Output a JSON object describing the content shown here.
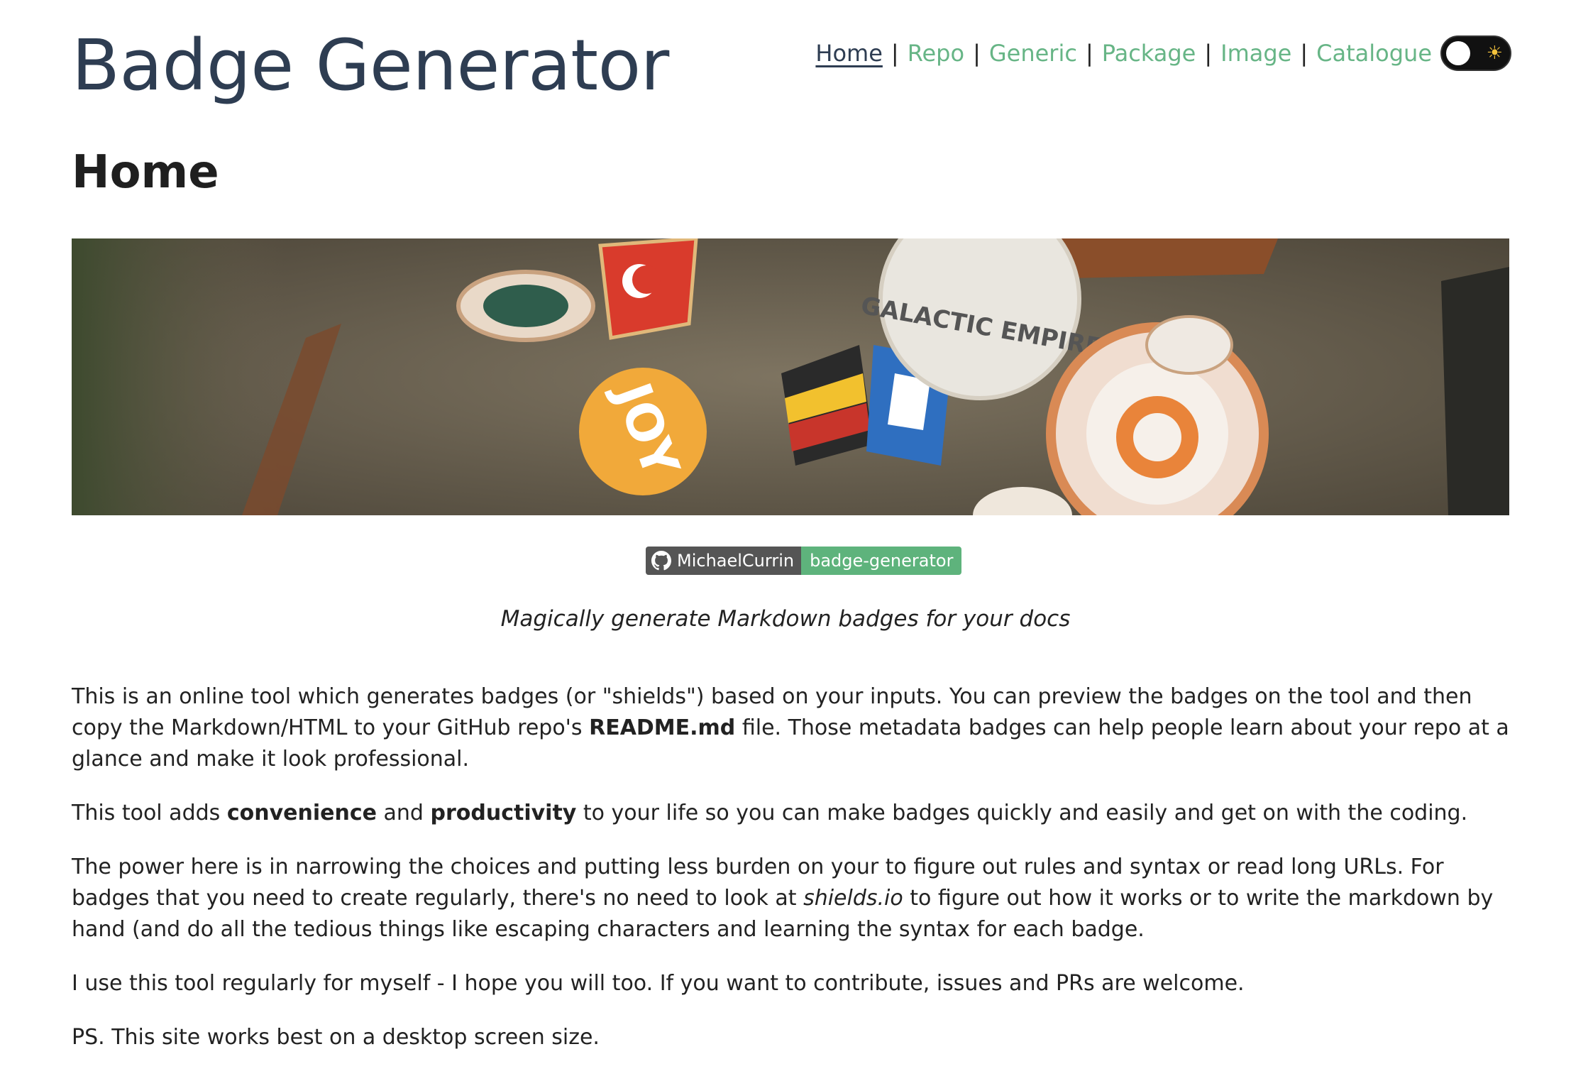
{
  "header": {
    "site_title": "Badge Generator"
  },
  "nav": {
    "items": [
      {
        "label": "Home",
        "active": true
      },
      {
        "label": "Repo"
      },
      {
        "label": "Generic"
      },
      {
        "label": "Package"
      },
      {
        "label": "Image"
      },
      {
        "label": "Catalogue"
      }
    ],
    "separator": "|",
    "theme_toggle_icon": "sun-icon",
    "link_color": "#67b586"
  },
  "main": {
    "page_heading": "Home",
    "hero_image_description": "pins-on-canvas-bag",
    "badge": {
      "icon": "github-icon",
      "left_label": "MichaelCurrin",
      "right_label": "badge-generator",
      "right_color": "#5eb37c"
    },
    "tagline": "Magically generate Markdown badges for your docs",
    "paragraphs": {
      "p1": {
        "part1": "This is an online tool which generates badges (or \"shields\") based on your inputs. You can preview the badges on the tool and then copy the Markdown/HTML to your GitHub repo's ",
        "bold1": "README.md",
        "part2": " file. Those metadata badges can help people learn about your repo at a glance and make it look professional."
      },
      "p2": {
        "part1": "This tool adds ",
        "bold1": "convenience",
        "part2": " and ",
        "bold2": "productivity",
        "part3": " to your life so you can make badges quickly and easily and get on with the coding."
      },
      "p3": {
        "part1": "The power here is in narrowing the choices and putting less burden on your to figure out rules and syntax or read long URLs. For badges that you need to create regularly, there's no need to look at ",
        "italic1": "shields.io",
        "part2": " to figure out how it works or to write the markdown by hand (and do all the tedious things like escaping characters and learning the syntax for each badge."
      },
      "p4": "I use this tool regularly for myself - I hope you will too. If you want to contribute, issues and PRs are welcome.",
      "p5": "PS. This site works best on a desktop screen size."
    }
  }
}
